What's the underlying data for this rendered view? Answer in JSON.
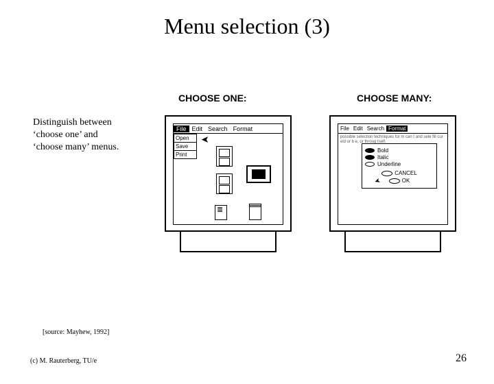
{
  "title": "Menu selection (3)",
  "caption_line1": "Distinguish between",
  "caption_line2": "‘choose one’ and",
  "caption_line3": "‘choose many’ menus.",
  "labels": {
    "one": "CHOOSE ONE:",
    "many": "CHOOSE MANY:"
  },
  "menubar": {
    "file": "File",
    "edit": "Edit",
    "search": "Search",
    "format": "Format"
  },
  "dropdown": {
    "open": "Open",
    "save": "Save",
    "print": "Print"
  },
  "dialog": {
    "bold": "Bold",
    "italic": "Italic",
    "underline": "Underline",
    "cancel": "CANCEL",
    "ok": "OK",
    "caption": "possible selection techniques for m can t and sele fill cur eld or b e, or throug tself."
  },
  "footer": {
    "source": "[source: Mayhew, 1992]",
    "copyright": "(c) M. Rauterberg, TU/e",
    "page": "26"
  }
}
